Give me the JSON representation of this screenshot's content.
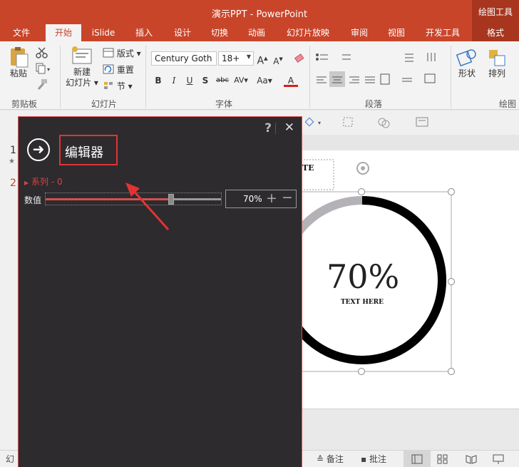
{
  "window": {
    "title": "演示PPT - PowerPoint",
    "contextual_tab": "绘图工具"
  },
  "tabs": [
    "文件",
    "开始",
    "iSlide",
    "插入",
    "设计",
    "切换",
    "动画",
    "幻灯片放映",
    "审阅",
    "视图",
    "开发工具",
    "格式"
  ],
  "active_tab": "开始",
  "ribbon": {
    "clipboard": {
      "label": "剪贴板",
      "paste": "粘贴"
    },
    "slides": {
      "label": "幻灯片",
      "new_slide": "新建",
      "new_slide_line2": "幻灯片",
      "layout": "版式",
      "reset": "重置",
      "section": "节"
    },
    "font": {
      "label": "字体",
      "font_name": "Century Goth",
      "font_size": "18+"
    },
    "paragraph": {
      "label": "段落"
    },
    "drawing": {
      "label": "绘图",
      "shape": "形状",
      "arrange": "排列"
    }
  },
  "colors": {
    "accent": "#c9452a",
    "panel_bg": "#2d2b2e",
    "highlight_red": "#e03434"
  },
  "thumbnails": {
    "first": "1",
    "second": "2"
  },
  "slide": {
    "text_box": "TE",
    "percent": "70%",
    "subtitle": "TEXT HERE",
    "progress": 0.7
  },
  "editor": {
    "title": "编辑器",
    "help": "?",
    "close": "✕",
    "series": "系列 - 0",
    "value_label": "数值",
    "value": "70%",
    "slider_value": 0.7
  },
  "statusbar": {
    "left": "幻",
    "notes": "备注",
    "comments": "批注"
  }
}
